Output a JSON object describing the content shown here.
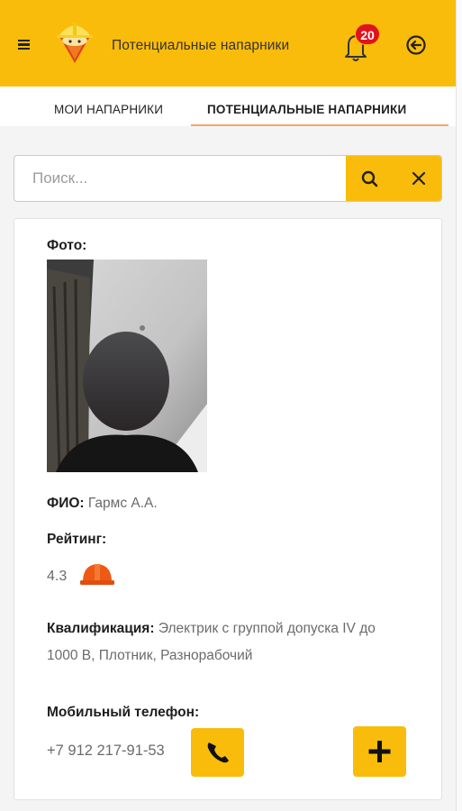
{
  "header": {
    "title": "Потенциальные напарники",
    "notifications_count": "20",
    "icons": {
      "menu": "hamburger-menu-icon",
      "logo": "hardhat-mascot-logo",
      "notifications": "bell-icon",
      "exit": "logout-arrow-icon"
    }
  },
  "tabs": [
    {
      "label": "МОИ НАПАРНИКИ",
      "active": false
    },
    {
      "label": "ПОТЕНЦИАЛЬНЫЕ НАПАРНИКИ",
      "active": true
    }
  ],
  "search": {
    "placeholder": "Поиск...",
    "value": "",
    "icons": {
      "search": "search-icon",
      "clear": "close-icon"
    }
  },
  "partner": {
    "photo_label": "Фото:",
    "name_label": "ФИО:",
    "name": "Гармс А.А.",
    "rating_label": "Рейтинг:",
    "rating": "4.3",
    "rating_icon": "helmet-icon",
    "qualification_label": "Квалификация:",
    "qualification": "Электрик с группой допуска IV до 1000 В, Плотник, Разнорабочий",
    "phone_label": "Мобильный телефон:",
    "phone": "+7 912 217-91-53",
    "actions": {
      "call_icon": "phone-icon",
      "add_icon": "plus-icon"
    }
  },
  "colors": {
    "accent": "#f9bc0b",
    "badge": "#e3111b",
    "helmet": "#ee5a14",
    "tab_underline": "#f0a96c"
  }
}
